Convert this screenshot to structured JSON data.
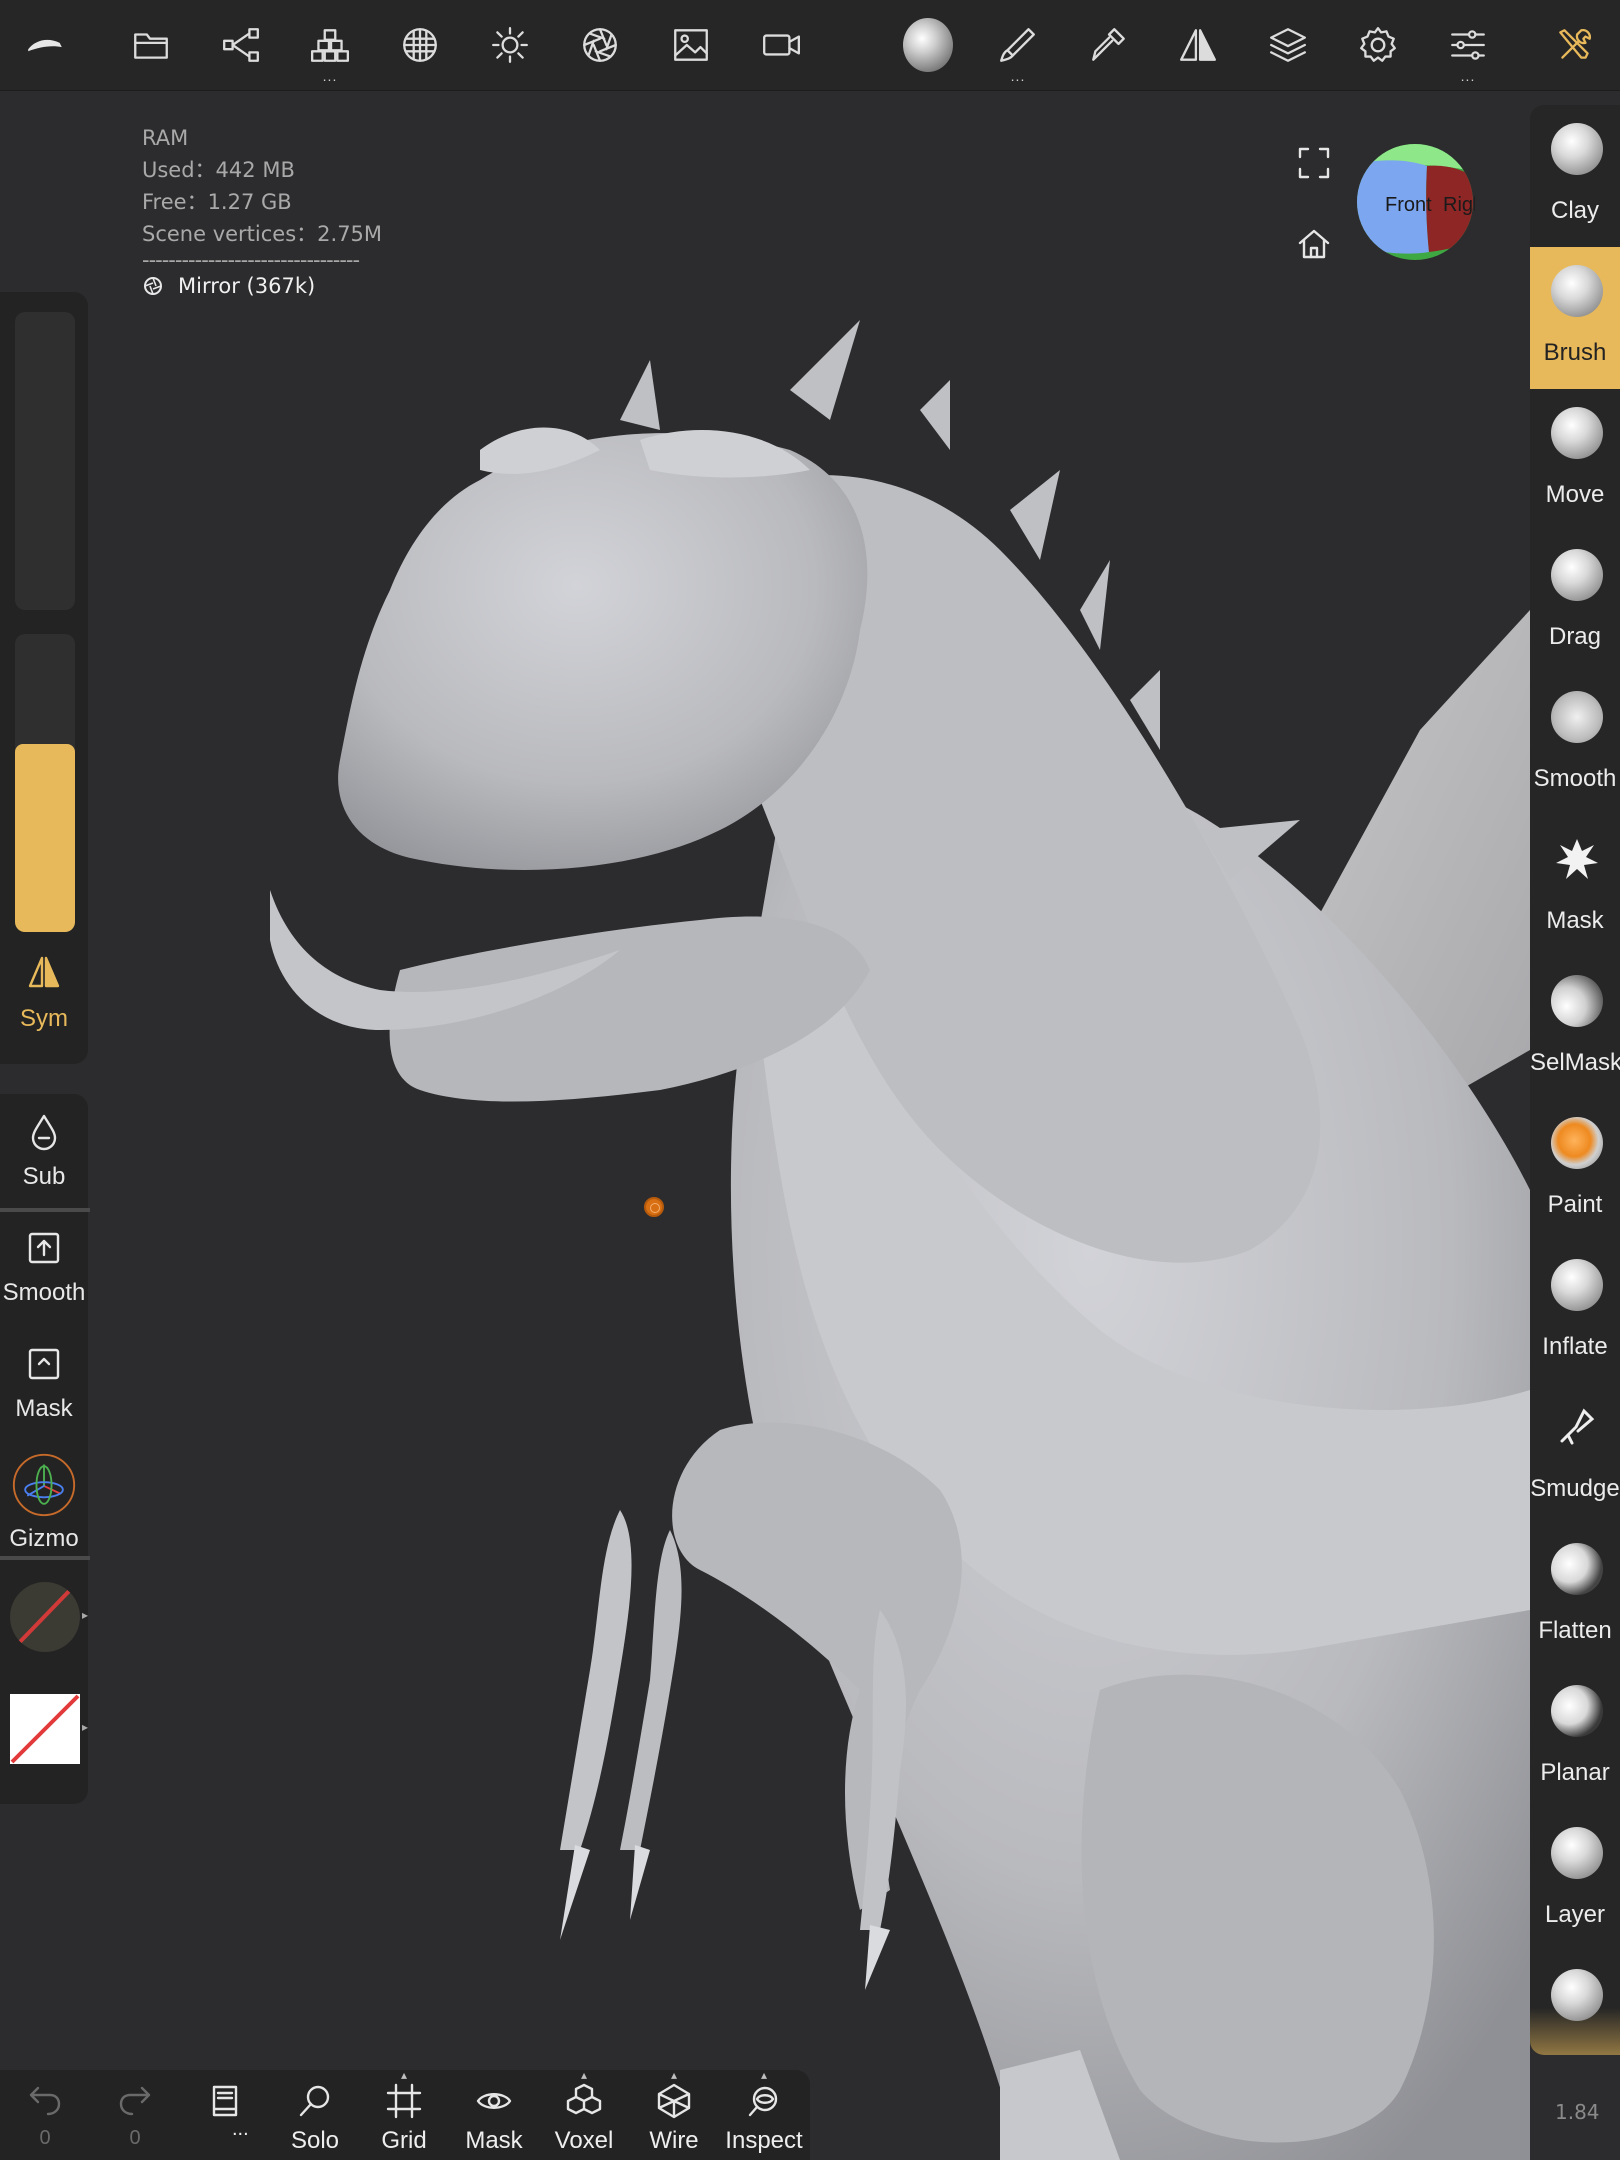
{
  "topbar": {
    "tools": [
      {
        "icon": "app-logo-icon"
      },
      {
        "icon": "folder-icon"
      },
      {
        "icon": "scene-graph-icon"
      },
      {
        "icon": "primitives-icon"
      },
      {
        "icon": "topology-icon"
      },
      {
        "icon": "lighting-icon"
      },
      {
        "icon": "camera-aperture-icon"
      },
      {
        "icon": "image-icon"
      },
      {
        "icon": "video-camera-icon"
      },
      {
        "icon": "material-sphere-icon"
      },
      {
        "icon": "paint-brush-icon"
      },
      {
        "icon": "picker-icon"
      },
      {
        "icon": "symmetry-icon"
      },
      {
        "icon": "layers-icon"
      },
      {
        "icon": "settings-gear-icon"
      },
      {
        "icon": "sliders-icon"
      },
      {
        "icon": "tools-icon"
      }
    ],
    "accent": "#e8b95a"
  },
  "hud": {
    "ram_label": "RAM",
    "used": "Used：442 MB",
    "free": "Free：1.27 GB",
    "scene_vertices": "Scene vertices：2.75M",
    "separator": "---------------------------------",
    "mirror": "Mirror (367k)"
  },
  "view_cube": {
    "front": "Front",
    "right": "Righ"
  },
  "left_panel": {
    "radius_slider": {
      "value": 0.0
    },
    "intensity_slider": {
      "value": 0.63
    },
    "sym_label": "Sym",
    "sub_label": "Sub",
    "smooth_label": "Smooth",
    "mask_label": "Mask",
    "gizmo_label": "Gizmo"
  },
  "right_panel": {
    "tools": [
      {
        "label": "Clay",
        "active": false
      },
      {
        "label": "Brush",
        "active": true
      },
      {
        "label": "Move",
        "active": false
      },
      {
        "label": "Drag",
        "active": false
      },
      {
        "label": "Smooth",
        "active": false
      },
      {
        "label": "Mask",
        "active": false
      },
      {
        "label": "SelMask",
        "active": false
      },
      {
        "label": "Paint",
        "active": false
      },
      {
        "label": "Inflate",
        "active": false
      },
      {
        "label": "Smudge",
        "active": false
      },
      {
        "label": "Flatten",
        "active": false
      },
      {
        "label": "Planar",
        "active": false
      },
      {
        "label": "Layer",
        "active": false
      },
      {
        "label": "",
        "active": false
      }
    ]
  },
  "bottom_bar": {
    "undo_count": "0",
    "redo_count": "0",
    "more_label": "...",
    "solo_label": "Solo",
    "grid_label": "Grid",
    "mask_label": "Mask",
    "voxel_label": "Voxel",
    "wire_label": "Wire",
    "inspect_label": "Inspect"
  },
  "version": "1.84"
}
